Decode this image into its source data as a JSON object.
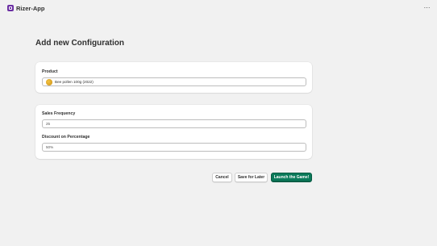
{
  "app": {
    "name": "Rizer-App",
    "menu_icon": "ellipsis-icon"
  },
  "page": {
    "title": "Add new Configuration"
  },
  "product": {
    "label": "Product",
    "value": "Bee pollen 100g (2022)",
    "thumbnail_icon": "product-thumbnail"
  },
  "settings": {
    "sales_frequency": {
      "label": "Sales Frequency",
      "value": "25"
    },
    "discount": {
      "label": "Discount on Percentage",
      "value": "50%"
    }
  },
  "actions": {
    "cancel": "Cancel",
    "save_later": "Save for Later",
    "launch": "Launch the Game!"
  },
  "colors": {
    "accent": "#0b7a5a",
    "brand": "#6b2fa3",
    "background": "#f1f1f1"
  }
}
